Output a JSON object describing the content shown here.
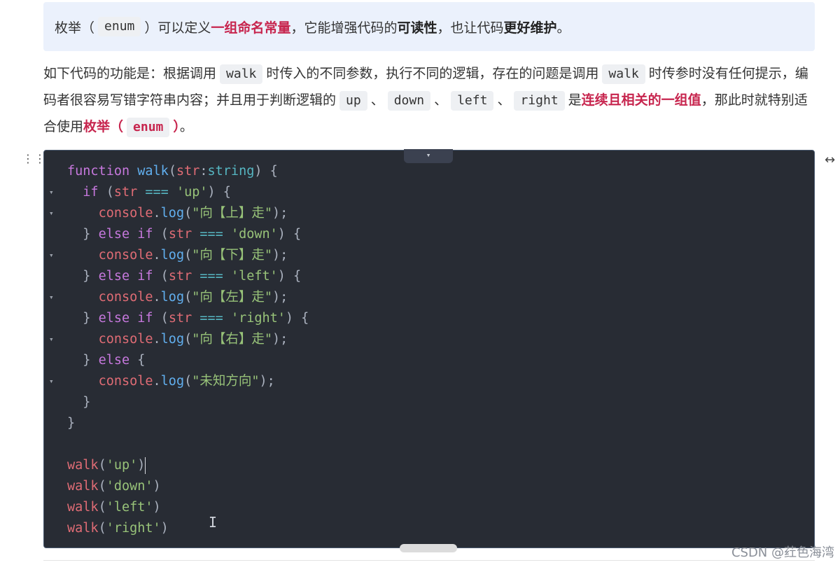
{
  "callout": {
    "t1": "枚举",
    "p1": "（",
    "code": "enum",
    "p2": "）",
    "t2": "可以定义",
    "r1": "一组命名常量",
    "t3": "，它能增强代码的",
    "b1": "可读性",
    "t4": "，也让代码",
    "b2": "更好维护",
    "t5": "。"
  },
  "para": {
    "t1": "如下代码的功能是：根据调用",
    "c1": "walk",
    "t2": "时传入的不同参数，执行不同的逻辑，存在的问题是调用",
    "c2": "walk",
    "t3": "时传参时没有任何提示，编码者很容易写错字符串内容；并且用于判断逻辑的",
    "c3": "up",
    "s1": "、",
    "c4": "down",
    "s2": "、",
    "c5": "left",
    "s3": "、",
    "c6": "right",
    "t4": "是",
    "r1": "连续且相关的一组值",
    "t5": "，那此时就特别适合使用",
    "r2a": "枚举（",
    "rc": "enum",
    "r2b": "）",
    "t6": "。"
  },
  "code": {
    "l1": {
      "kw": "function",
      "fn": "walk",
      "p1": "(",
      "param": "str",
      "colon": ":",
      "type": "string",
      "p2": ") {"
    },
    "l2": {
      "kw": "if",
      "p1": " (",
      "var": "str",
      "op": " === ",
      "str": "'up'",
      "p2": ") {"
    },
    "l3": {
      "obj": "console",
      "dot": ".",
      "fn": "log",
      "p1": "(",
      "str": "\"向【上】走\"",
      "p2": ");"
    },
    "l4": {
      "p0": "} ",
      "kw": "else if",
      "p1": " (",
      "var": "str",
      "op": " === ",
      "str": "'down'",
      "p2": ") {"
    },
    "l5": {
      "obj": "console",
      "dot": ".",
      "fn": "log",
      "p1": "(",
      "str": "\"向【下】走\"",
      "p2": ");"
    },
    "l6": {
      "p0": "} ",
      "kw": "else if",
      "p1": " (",
      "var": "str",
      "op": " === ",
      "str": "'left'",
      "p2": ") {"
    },
    "l7": {
      "obj": "console",
      "dot": ".",
      "fn": "log",
      "p1": "(",
      "str": "\"向【左】走\"",
      "p2": ");"
    },
    "l8": {
      "p0": "} ",
      "kw": "else if",
      "p1": " (",
      "var": "str",
      "op": " === ",
      "str": "'right'",
      "p2": ") {"
    },
    "l9": {
      "obj": "console",
      "dot": ".",
      "fn": "log",
      "p1": "(",
      "str": "\"向【右】走\"",
      "p2": ");"
    },
    "l10": {
      "p0": "} ",
      "kw": "else",
      "p2": " {"
    },
    "l11": {
      "obj": "console",
      "dot": ".",
      "fn": "log",
      "p1": "(",
      "str": "\"未知方向\"",
      "p2": ");"
    },
    "l12": "}",
    "l13": "}",
    "c1": {
      "fn": "walk",
      "p1": "(",
      "str": "'up'",
      "p2": ")"
    },
    "c2": {
      "fn": "walk",
      "p1": "(",
      "str": "'down'",
      "p2": ")"
    },
    "c3": {
      "fn": "walk",
      "p1": "(",
      "str": "'left'",
      "p2": ")"
    },
    "c4": {
      "fn": "walk",
      "p1": "(",
      "str": "'right'",
      "p2": ")"
    }
  },
  "icons": {
    "fold": "▾",
    "collapse": "▾",
    "drag": "⋮⋮",
    "expand": "↔",
    "ibeam": "I"
  },
  "watermark": "CSDN @荭色海湾"
}
